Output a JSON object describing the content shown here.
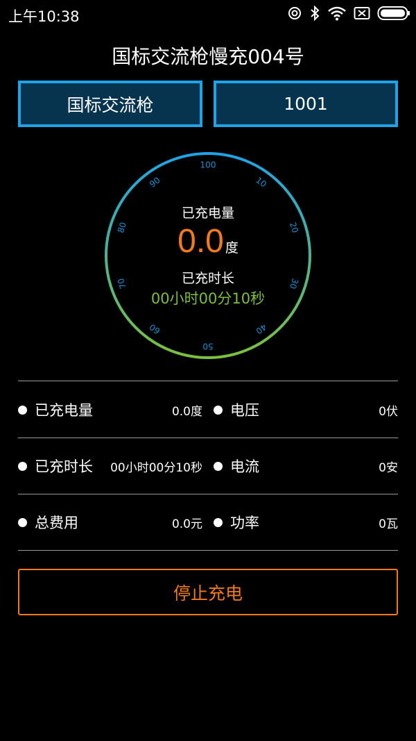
{
  "status_bar": {
    "time": "上午10:38",
    "icons": [
      "hotspot-icon",
      "bluetooth-icon",
      "wifi-icon",
      "no-sim-icon",
      "battery-icon"
    ]
  },
  "header": {
    "title": "国标交流枪慢充004号"
  },
  "info": {
    "gun_type": "国标交流枪",
    "code": "1001"
  },
  "gauge": {
    "ticks": [
      "100",
      "10",
      "20",
      "30",
      "40",
      "50",
      "60",
      "70",
      "80",
      "90"
    ],
    "energy_label": "已充电量",
    "energy_value": "0.0",
    "energy_unit": "度",
    "time_label": "已充时长",
    "time_value": "00小时00分10秒",
    "colors": {
      "top": "#1fa3e6",
      "bottom": "#7cbf3f"
    }
  },
  "details": [
    {
      "left_label": "已充电量",
      "left_value": "0.0度",
      "right_label": "电压",
      "right_value": "0伏"
    },
    {
      "left_label": "已充时长",
      "left_value": "00小时00分10秒",
      "right_label": "电流",
      "right_value": "0安"
    },
    {
      "left_label": "总费用",
      "left_value": "0.0元",
      "right_label": "功率",
      "right_value": "0瓦"
    }
  ],
  "actions": {
    "stop_label": "停止充电"
  },
  "colors": {
    "accent_orange": "#f07a1c",
    "box_border": "#1fa3e6",
    "box_fill": "#06334d",
    "time_green": "#7cbf3f"
  }
}
